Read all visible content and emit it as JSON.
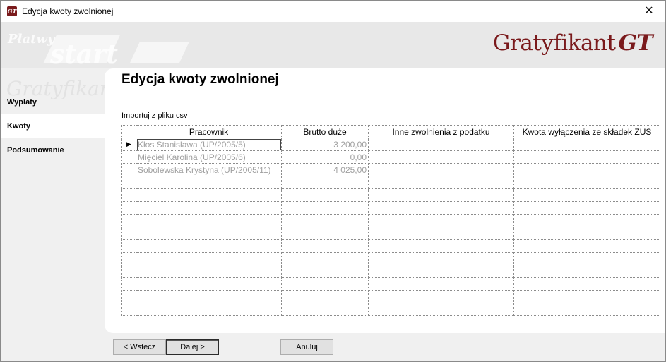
{
  "window": {
    "title": "Edycja kwoty zwolnionej",
    "close_glyph": "✕",
    "app_icon_text": "GT"
  },
  "header": {
    "watermark_1": "Płatwy",
    "watermark_2": "start",
    "watermark_3": "Gratyfikant",
    "logo_text": "Gratyfikant",
    "logo_mark": "GT",
    "brand_color": "#7a1a1c"
  },
  "sidebar": {
    "items": [
      {
        "label": "Wypłaty",
        "active": false
      },
      {
        "label": "Kwoty",
        "active": true
      },
      {
        "label": "Podsumowanie",
        "active": false
      }
    ]
  },
  "main": {
    "title": "Edycja kwoty zwolnionej",
    "import_link": "Importuj z pliku csv",
    "grid": {
      "columns": [
        "Pracownik",
        "Brutto duże",
        "Inne zwolnienia z podatku",
        "Kwota wyłączenia ze składek ZUS"
      ],
      "current_row_indicator": "▶",
      "rows": [
        [
          "Kłos Stanisława (UP/2005/5)",
          "3 200,00",
          "",
          ""
        ],
        [
          "Mięciel Karolina (UP/2005/6)",
          "0,00",
          "",
          ""
        ],
        [
          "Sobolewska Krystyna (UP/2005/11)",
          "4 025,00",
          "",
          ""
        ]
      ]
    }
  },
  "footer": {
    "back_label": "< Wstecz",
    "next_label": "Dalej >",
    "cancel_label": "Anuluj"
  }
}
